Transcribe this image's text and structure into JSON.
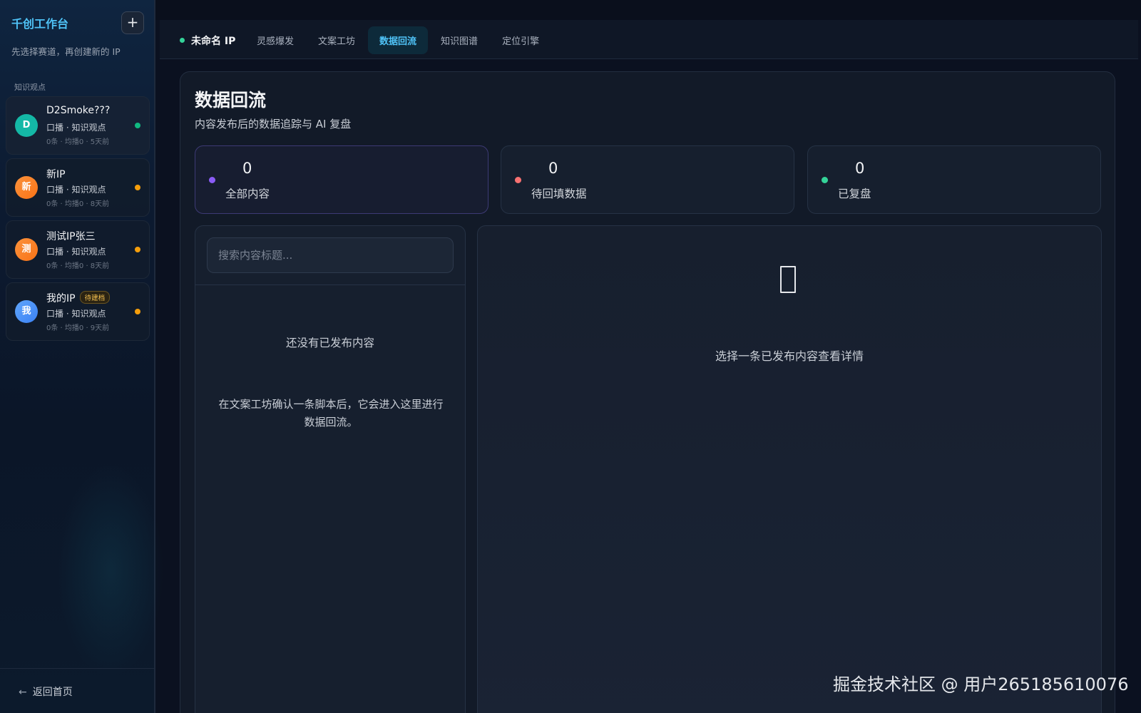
{
  "sidebar": {
    "brand": "千创工作台",
    "add_label": "+",
    "hint": "先选择赛道，再创建新的 IP",
    "section_label": "知识观点",
    "items": [
      {
        "initial": "D",
        "name": "D2Smoke???",
        "tag": "",
        "subtitle": "口播 · 知识观点",
        "meta": "0条 · 均播0 · 5天前",
        "avatar_color": "#14b8a6",
        "status_color": "#10b981"
      },
      {
        "initial": "新",
        "name": "新IP",
        "tag": "",
        "subtitle": "口播 · 知识观点",
        "meta": "0条 · 均播0 · 8天前",
        "avatar_color": "#f97316",
        "status_color": "#f59e0b"
      },
      {
        "initial": "测",
        "name": "测试IP张三",
        "tag": "",
        "subtitle": "口播 · 知识观点",
        "meta": "0条 · 均播0 · 8天前",
        "avatar_color": "#f97316",
        "status_color": "#f59e0b"
      },
      {
        "initial": "我",
        "name": "我的IP",
        "tag": "待建档",
        "subtitle": "口播 · 知识观点",
        "meta": "0条 · 均播0 · 9天前",
        "avatar_color": "#3b82f6",
        "status_color": "#f59e0b"
      }
    ],
    "back_label": "返回首页",
    "back_icon": "arrow-left-icon"
  },
  "topbar": {
    "ip_name": "未命名 IP",
    "tabs": [
      "灵感爆发",
      "文案工坊",
      "数据回流",
      "知识图谱",
      "定位引擎"
    ],
    "active_tab": "数据回流"
  },
  "main": {
    "title": "数据回流",
    "subtitle": "内容发布后的数据追踪与 AI 复盘",
    "stats": [
      {
        "value": "0",
        "label": "全部内容",
        "color": "#8b5cf6"
      },
      {
        "value": "0",
        "label": "待回填数据",
        "color": "#f87171"
      },
      {
        "value": "0",
        "label": "已复盘",
        "color": "#34d399"
      }
    ],
    "search_placeholder": "搜索内容标题...",
    "empty_title": "还没有已发布内容",
    "empty_desc": "在文案工坊确认一条脚本后，它会进入这里进行数据回流。",
    "detail_icon": "document-placeholder-icon",
    "detail_hint": "选择一条已发布内容查看详情"
  },
  "watermark": "掘金技术社区 @ 用户265185610076"
}
